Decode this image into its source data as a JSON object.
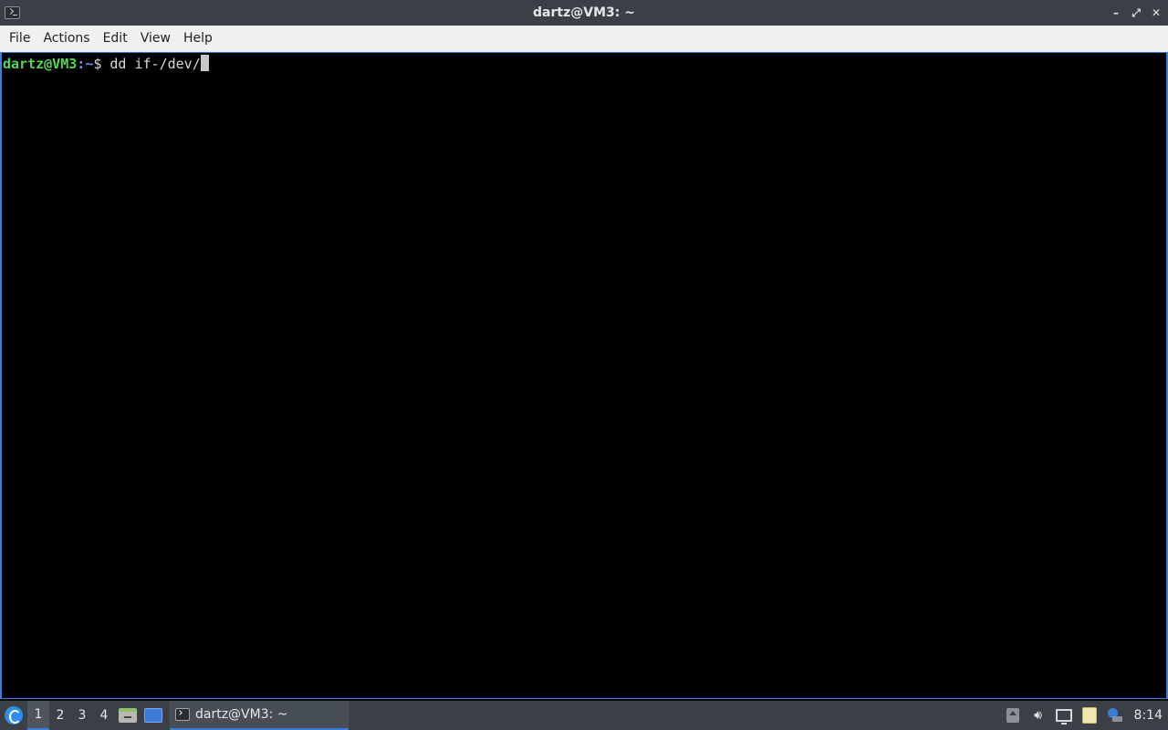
{
  "window": {
    "title": "dartz@VM3: ~"
  },
  "menu": {
    "items": [
      "File",
      "Actions",
      "Edit",
      "View",
      "Help"
    ]
  },
  "terminal": {
    "prompt_user": "dartz@VM3",
    "prompt_sep": ":",
    "prompt_path": "~",
    "prompt_symbol": "$ ",
    "command": "dd if-/dev/"
  },
  "taskbar": {
    "workspaces": [
      "1",
      "2",
      "3",
      "4"
    ],
    "active_workspace": "1",
    "task_label": "dartz@VM3: ~",
    "clock": "8:14"
  },
  "colors": {
    "accent": "#3d7bd6",
    "prompt_user": "#55d655",
    "prompt_path": "#6f8cff",
    "titlebar_bg": "#3b4047",
    "menubar_bg": "#eff0f1"
  }
}
